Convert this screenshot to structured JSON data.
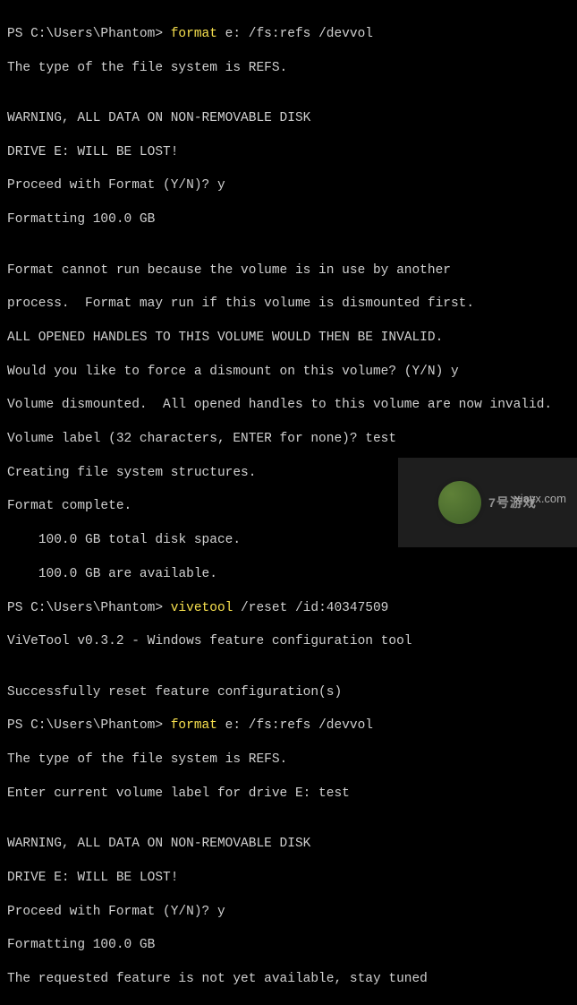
{
  "terminal": {
    "prompt": "PS C:\\Users\\Phantom> ",
    "cmd_format": "format",
    "cmd_format_args": " e: /fs:refs /devvol",
    "cmd_vivetool": "vivetool",
    "cmd_vivetool_args": " /reset /id:40347509",
    "lines": {
      "l01": "The type of the file system is REFS.",
      "l02": "",
      "l03": "WARNING, ALL DATA ON NON-REMOVABLE DISK",
      "l04": "DRIVE E: WILL BE LOST!",
      "l05": "Proceed with Format (Y/N)? y",
      "l06": "Formatting 100.0 GB",
      "l07": "",
      "l08": "Format cannot run because the volume is in use by another",
      "l09": "process.  Format may run if this volume is dismounted first.",
      "l10": "ALL OPENED HANDLES TO THIS VOLUME WOULD THEN BE INVALID.",
      "l11": "Would you like to force a dismount on this volume? (Y/N) y",
      "l12": "Volume dismounted.  All opened handles to this volume are now invalid.",
      "l13": "Volume label (32 characters, ENTER for none)? test",
      "l14": "Creating file system structures.",
      "l15": "Format complete.",
      "l16": "    100.0 GB total disk space.",
      "l17": "    100.0 GB are available.",
      "l18": "ViVeTool v0.3.2 - Windows feature configuration tool",
      "l19": "",
      "l20": "Successfully reset feature configuration(s)",
      "l21": "The type of the file system is REFS.",
      "l22": "Enter current volume label for drive E: test",
      "l23": "",
      "l24": "WARNING, ALL DATA ON NON-REMOVABLE DISK",
      "l25": "DRIVE E: WILL BE LOST!",
      "l26": "Proceed with Format (Y/N)? y",
      "l27": "Formatting 100.0 GB",
      "l28": "The requested feature is not yet available, stay tuned"
    }
  },
  "watermark": {
    "text_main": "7号游戏",
    "text_sub": "xiayx.com"
  }
}
